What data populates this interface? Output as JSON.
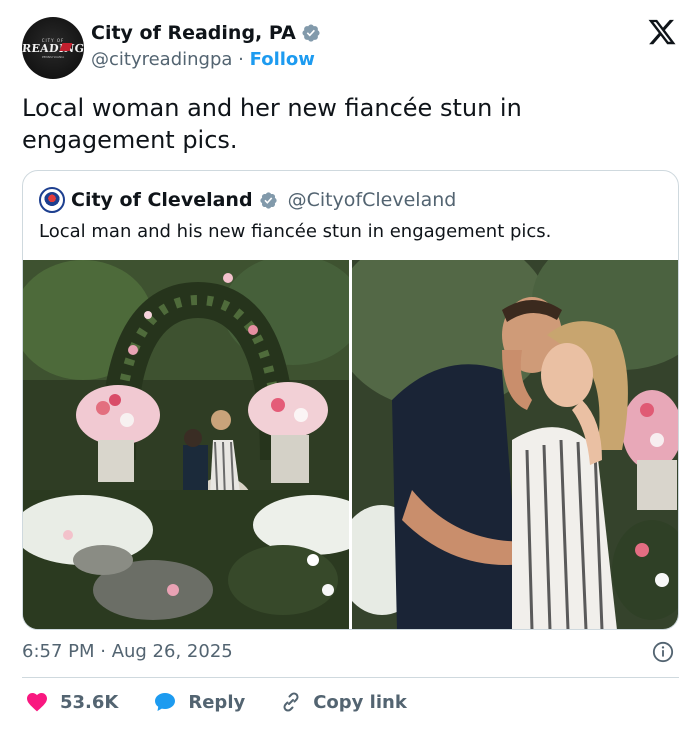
{
  "author": {
    "name": "City of Reading, PA",
    "handle": "@cityreadingpa",
    "separator": "·",
    "follow_label": "Follow",
    "avatar": {
      "top_text": "CITY OF",
      "main_text": "READING",
      "bottom_text": "PENNSYLVANIA"
    }
  },
  "tweet": {
    "text": "Local woman and her new fiancée stun in engagement pics."
  },
  "quoted": {
    "name": "City of Cleveland",
    "handle": "@CityofCleveland",
    "text": "Local man and his new fiancée stun in engagement pics."
  },
  "meta": {
    "timestamp": "6:57 PM · Aug 26, 2025"
  },
  "actions": {
    "like_count": "53.6K",
    "reply_label": "Reply",
    "copy_label": "Copy link"
  },
  "colors": {
    "accent": "#1d9bf0",
    "like": "#f91880",
    "verified": "#829aab",
    "text_secondary": "#536471"
  },
  "icons": [
    "x-logo-icon",
    "verified-badge-icon",
    "info-icon",
    "heart-icon",
    "reply-bubble-icon",
    "link-icon"
  ]
}
